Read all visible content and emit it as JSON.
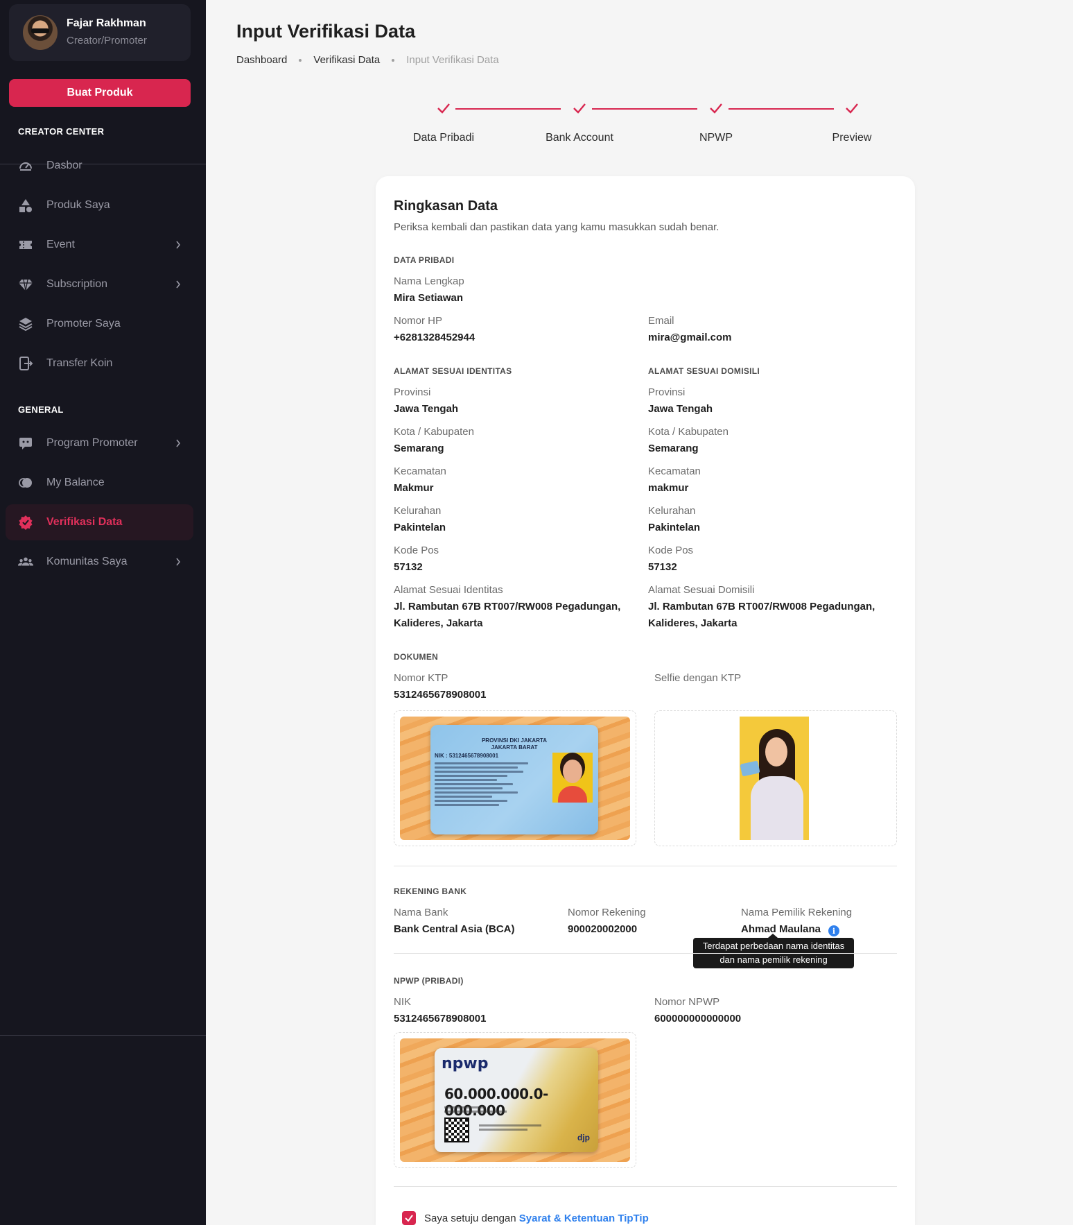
{
  "sidebar": {
    "profile": {
      "name": "Fajar Rakhman",
      "role": "Creator/Promoter"
    },
    "create_button": "Buat Produk",
    "section_creator": "CREATOR CENTER",
    "section_general": "GENERAL",
    "items": [
      {
        "label": "Dasbor",
        "icon": "dashboard-gauge-icon"
      },
      {
        "label": "Produk Saya",
        "icon": "shapes-icon"
      },
      {
        "label": "Event",
        "icon": "ticket-icon"
      },
      {
        "label": "Subscription",
        "icon": "diamond-icon"
      },
      {
        "label": "Promoter Saya",
        "icon": "layers-icon"
      },
      {
        "label": "Transfer Koin",
        "icon": "transfer-icon"
      },
      {
        "label": "Program Promoter",
        "icon": "chat-icon"
      },
      {
        "label": "My Balance",
        "icon": "coins-icon"
      },
      {
        "label": "Verifikasi Data",
        "icon": "verified-badge-icon"
      },
      {
        "label": "Komunitas Saya",
        "icon": "users-icon"
      }
    ]
  },
  "header": {
    "title": "Input Verifikasi Data",
    "breadcrumb": [
      "Dashboard",
      "Verifikasi Data",
      "Input Verifikasi Data"
    ]
  },
  "stepper": {
    "steps": [
      "Data Pribadi",
      "Bank Account",
      "NPWP",
      "Preview"
    ]
  },
  "summary": {
    "title": "Ringkasan Data",
    "subtitle": "Periksa kembali dan pastikan data yang kamu masukkan sudah benar.",
    "personal": {
      "heading": "DATA PRIBADI",
      "name_label": "Nama Lengkap",
      "name": "Mira Setiawan",
      "phone_label": "Nomor HP",
      "phone": "+6281328452944",
      "email_label": "Email",
      "email": "mira@gmail.com"
    },
    "address_id": {
      "heading": "ALAMAT SESUAI IDENTITAS",
      "province_label": "Provinsi",
      "province": "Jawa Tengah",
      "city_label": "Kota / Kabupaten",
      "city": "Semarang",
      "district_label": "Kecamatan",
      "district": "Makmur",
      "village_label": "Kelurahan",
      "village": "Pakintelan",
      "zip_label": "Kode Pos",
      "zip": "57132",
      "address_label": "Alamat Sesuai Identitas",
      "address_line1": "Jl. Rambutan 67B RT007/RW008 Pegadungan,",
      "address_line2": "Kalideres, Jakarta"
    },
    "address_dom": {
      "heading": "ALAMAT SESUAI DOMISILI",
      "province_label": "Provinsi",
      "province": "Jawa Tengah",
      "city_label": "Kota / Kabupaten",
      "city": "Semarang",
      "district_label": "Kecamatan",
      "district": "makmur",
      "village_label": "Kelurahan",
      "village": "Pakintelan",
      "zip_label": "Kode Pos",
      "zip": "57132",
      "address_label": "Alamat Sesuai Domisili",
      "address_line1": "Jl. Rambutan 67B RT007/RW008 Pegadungan,",
      "address_line2": "Kalideres, Jakarta"
    },
    "documents": {
      "heading": "DOKUMEN",
      "ktp_label": "Nomor KTP",
      "ktp": "5312465678908001",
      "selfie_label": "Selfie dengan KTP",
      "ktp_card": {
        "line1": "PROVINSI DKI JAKARTA",
        "line2": "JAKARTA BARAT",
        "nik": "NIK    :   5312465678908001"
      }
    },
    "bank": {
      "heading": "REKENING BANK",
      "bank_label": "Nama Bank",
      "bank": "Bank Central Asia (BCA)",
      "account_label": "Nomor Rekening",
      "account": "900020002000",
      "owner_label": "Nama Pemilik Rekening",
      "owner": "Ahmad Maulana",
      "tooltip_line1": "Terdapat perbedaan nama identitas",
      "tooltip_line2": "dan nama pemilik rekening"
    },
    "npwp": {
      "heading": "NPWP (PRIBADI)",
      "nik_label": "NIK",
      "nik": "5312465678908001",
      "npwp_label": "Nomor NPWP",
      "npwp": "600000000000000",
      "card": {
        "logo": "npwp",
        "number": "60.000.000.0-000.000",
        "brand": "djp"
      }
    },
    "agreement": {
      "text": "Saya setuju dengan ",
      "link": "Syarat & Ketentuan TipTip"
    }
  },
  "colors": {
    "accent": "#d8264f",
    "sidebar_bg": "#16161f",
    "link": "#2f80ed"
  }
}
